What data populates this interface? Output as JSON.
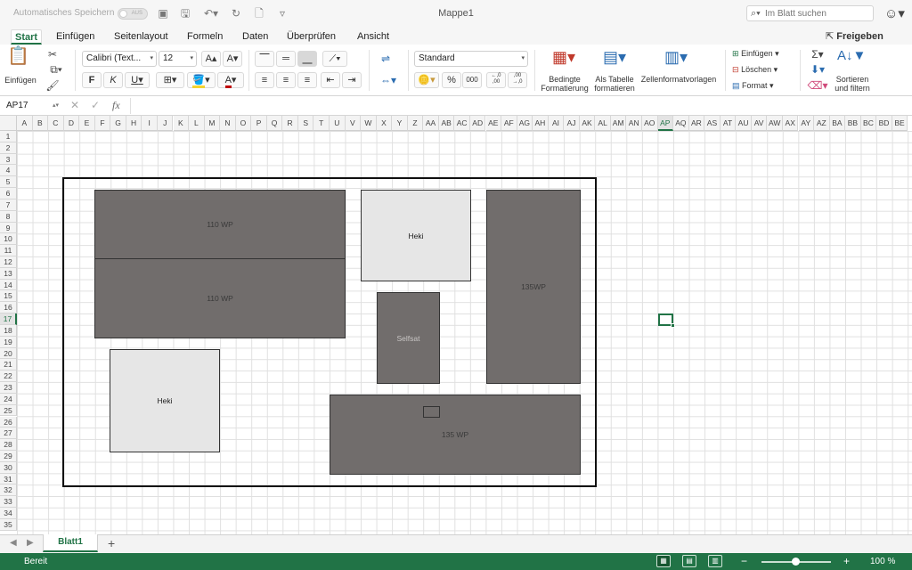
{
  "titlebar": {
    "autosave_label": "Automatisches Speichern",
    "autosave_state": "AUS",
    "doc_title": "Mappe1",
    "search_placeholder": "Im Blatt suchen"
  },
  "tabs": {
    "items": [
      "Start",
      "Einfügen",
      "Seitenlayout",
      "Formeln",
      "Daten",
      "Überprüfen",
      "Ansicht"
    ],
    "active": "Start",
    "share_label": "Freigeben"
  },
  "ribbon": {
    "paste_label": "Einfügen",
    "font_name": "Calibri (Text...",
    "font_size": "12",
    "number_format": "Standard",
    "bold": "F",
    "italic": "K",
    "underline": "U",
    "conditional_format": [
      "Bedingte",
      "Formatierung"
    ],
    "as_table": [
      "Als Tabelle",
      "formatieren"
    ],
    "cell_styles": "Zellenformatvorlagen",
    "insert_cells": "Einfügen",
    "delete_cells": "Löschen",
    "format_cells": "Format",
    "sort_filter": [
      "Sortieren",
      "und filtern"
    ],
    "percent": "%",
    "thousands": "000",
    "increase_decimal": "←,0\n,00",
    "decrease_decimal": ",00\n→,0"
  },
  "formula_bar": {
    "cell_ref": "AP17",
    "fx": "fx",
    "value": ""
  },
  "grid": {
    "columns": [
      "A",
      "B",
      "C",
      "D",
      "E",
      "F",
      "G",
      "H",
      "I",
      "J",
      "K",
      "L",
      "M",
      "N",
      "O",
      "P",
      "Q",
      "R",
      "S",
      "T",
      "U",
      "V",
      "W",
      "X",
      "Y",
      "Z",
      "AA",
      "AB",
      "AC",
      "AD",
      "AE",
      "AF",
      "AG",
      "AH",
      "AI",
      "AJ",
      "AK",
      "AL",
      "AM",
      "AN",
      "AO",
      "AP",
      "AQ",
      "AR",
      "AS",
      "AT",
      "AU",
      "AV",
      "AW",
      "AX",
      "AY",
      "AZ",
      "BA",
      "BB",
      "BC",
      "BD",
      "BE"
    ],
    "rows": [
      "1",
      "2",
      "3",
      "4",
      "5",
      "6",
      "7",
      "8",
      "9",
      "10",
      "11",
      "12",
      "13",
      "14",
      "15",
      "16",
      "17",
      "18",
      "19",
      "20",
      "21",
      "22",
      "23",
      "24",
      "25",
      "26",
      "27",
      "28",
      "29",
      "30",
      "31",
      "32",
      "33",
      "34",
      "35"
    ],
    "selected_column": "AP",
    "selected_row": "17"
  },
  "shapes": {
    "wp110_top": "110 WP",
    "wp110_bottom": "110 WP",
    "heki_top": "Heki",
    "selfsat": "Selfsat",
    "wp135_right": "135WP",
    "heki_bottom": "Heki",
    "wp135_bottom": "135 WP"
  },
  "sheetbar": {
    "sheet_name": "Blatt1",
    "add": "+"
  },
  "statusbar": {
    "status": "Bereit",
    "zoom": "100 %",
    "zoom_minus": "−",
    "zoom_plus": "+"
  },
  "colors": {
    "accent": "#217346",
    "panel_dark": "#716d6c",
    "panel_light": "#e6e6e6"
  }
}
